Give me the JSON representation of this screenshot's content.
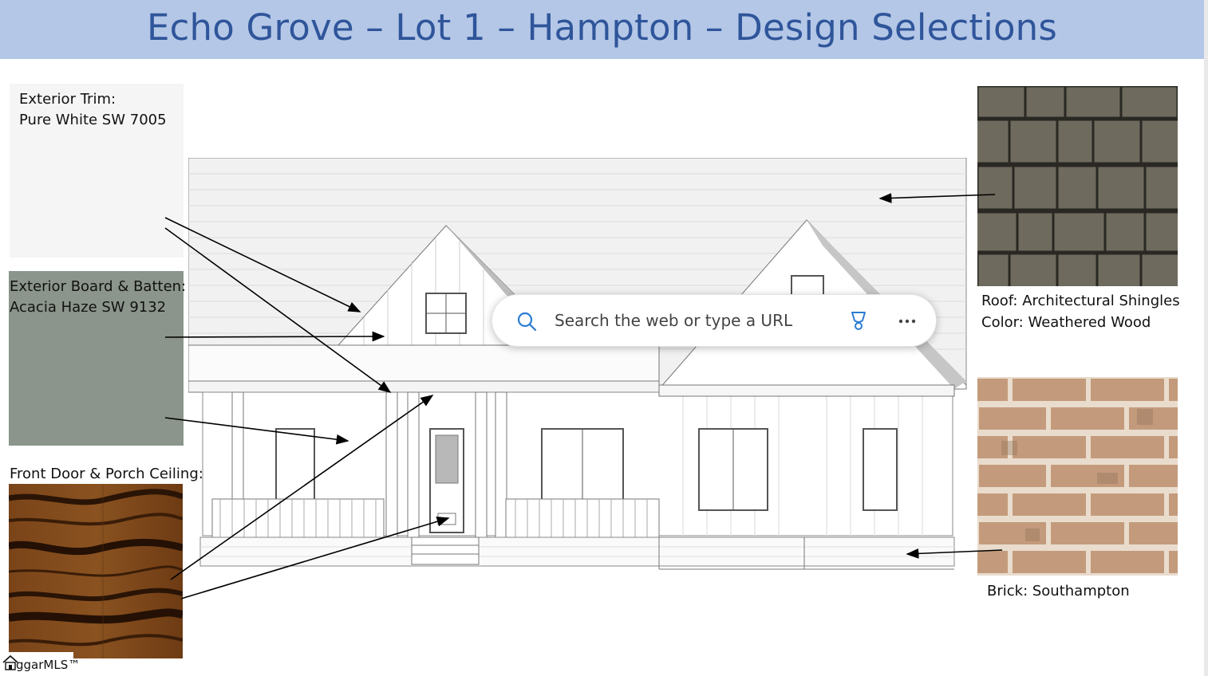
{
  "header": {
    "title": "Echo Grove – Lot 1 – Hampton – Design Selections"
  },
  "selections": {
    "trim": {
      "line1": "Exterior Trim:",
      "line2": "Pure White SW 7005",
      "color": "#f5f5f5"
    },
    "batten": {
      "line1": "Exterior Board & Batten:",
      "line2": "Acacia Haze SW 9132",
      "color": "#8b958b"
    },
    "door": {
      "label": "Front Door & Porch Ceiling:",
      "color": "#6b3a14"
    },
    "roof": {
      "line1": "Roof: Architectural Shingles",
      "line2": "Color: Weathered Wood"
    },
    "brick": {
      "label": "Brick: Southampton"
    }
  },
  "browser": {
    "search_placeholder": "Search the web or type a URL",
    "icons": [
      "search-icon",
      "trophy-icon",
      "more-icon"
    ]
  },
  "watermark": {
    "text": "ggarMLS™",
    "icon": "house-icon"
  },
  "colors": {
    "banner": "#b4c7e7",
    "title": "#2f559a"
  }
}
